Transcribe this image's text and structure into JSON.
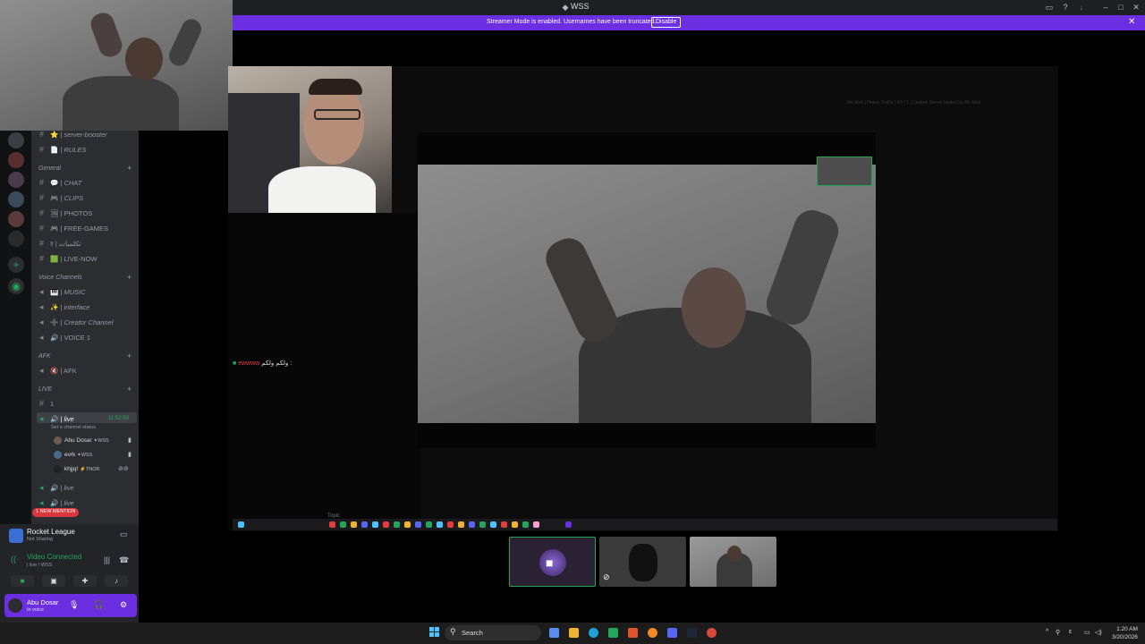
{
  "window": {
    "title": "WSS"
  },
  "banner": {
    "message": "Streamer Mode is enabled. Usernames have been truncated.",
    "disable_label": "Disable"
  },
  "channels": {
    "items": [
      {
        "label": "| server-booster",
        "emoji": "⭐"
      },
      {
        "label": "| RULES",
        "emoji": "📄"
      }
    ],
    "general_category": "General",
    "general": [
      {
        "label": "| CHAT",
        "emoji": "💬"
      },
      {
        "label": "| CLIPS",
        "emoji": "🎮"
      },
      {
        "label": "| PHOTOS",
        "emoji": "🖼"
      },
      {
        "label": "| FREE-GAMES",
        "emoji": "🎮"
      },
      {
        "label": "| تكلميات",
        "emoji": "‼"
      },
      {
        "label": "| LIVE-NOW",
        "emoji": "🟩"
      }
    ],
    "voice_category": "Voice Channels",
    "voice": [
      {
        "label": "| MUSIC",
        "emoji": "🎹"
      },
      {
        "label": "| interface",
        "emoji": "✨"
      },
      {
        "label": "| Creator Channel",
        "emoji": "➕"
      },
      {
        "label": "| VOICE 1",
        "emoji": "🔊"
      }
    ],
    "afk_category": "AFK",
    "afk": [
      {
        "label": "| AFK",
        "emoji": "🔇"
      }
    ],
    "live_category": "LIVE",
    "live_number": "1",
    "live_channel": "| live",
    "live_timer": "11:52:58",
    "live_status": "Set a channel status",
    "members": [
      {
        "name": "Abu Dosar",
        "tag": "WSS"
      },
      {
        "name": "evrk",
        "tag": "WSS"
      },
      {
        "name": "khjjq!",
        "tag": "TNOR"
      }
    ],
    "live_channels_extra": [
      "| live",
      "| live"
    ],
    "mention_badge": "1 NEW MENTION"
  },
  "user_panel": {
    "activity_title": "Rocket League",
    "activity_sub": "Not Sharing",
    "voice_title": "Video Connected",
    "voice_sub": "| live / WSS",
    "username": "Abu Dosar",
    "user_status": "In voice"
  },
  "stream": {
    "chat_name": "ewwww",
    "chat_text": "ولكم ولكم :",
    "topic_text": "Topic",
    "faded_title": "Mo Mod | Heavy Traffic | 4:5 | 1 | Custom Server hosted by Mo Mod"
  },
  "taskbar": {
    "search_label": "Search",
    "clock_time": "1:20 AM",
    "clock_date": "3/20/2026"
  },
  "colors": {
    "accent": "#6b2ee0",
    "green": "#23a55a",
    "red": "#da373c"
  }
}
